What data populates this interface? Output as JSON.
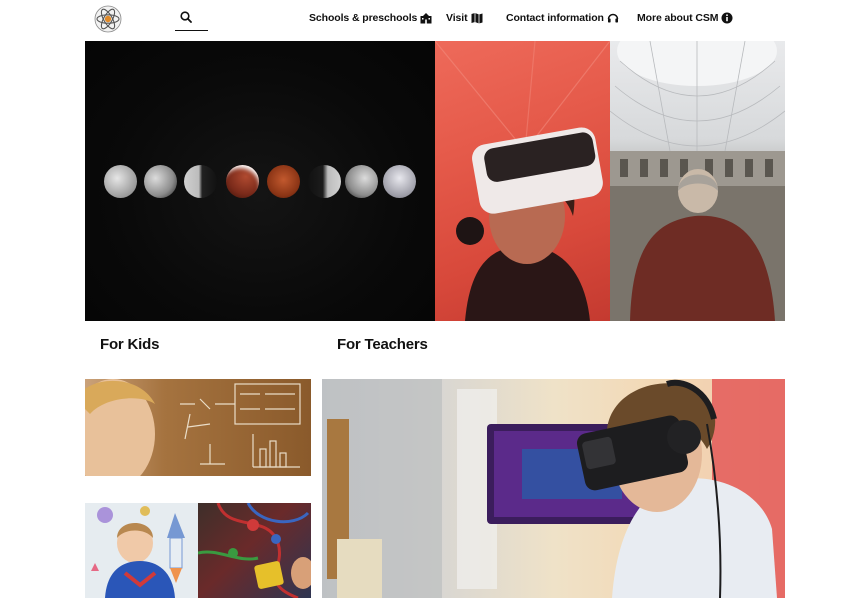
{
  "header": {
    "logo_name": "atom-logo-icon",
    "search_icon": "search-icon",
    "nav": [
      {
        "label": "Schools & preschools",
        "icon": "school-building-icon"
      },
      {
        "label": "Visit",
        "icon": "map-icon"
      },
      {
        "label": "Contact information",
        "icon": "headset-icon"
      },
      {
        "label": "More about CSM",
        "icon": "info-circle-icon"
      }
    ]
  },
  "sections": {
    "kids_label": "For Kids",
    "teachers_label": "For Teachers"
  },
  "colors": {
    "text": "#111111",
    "background": "#ffffff",
    "vr_red": "#e55a4a"
  }
}
